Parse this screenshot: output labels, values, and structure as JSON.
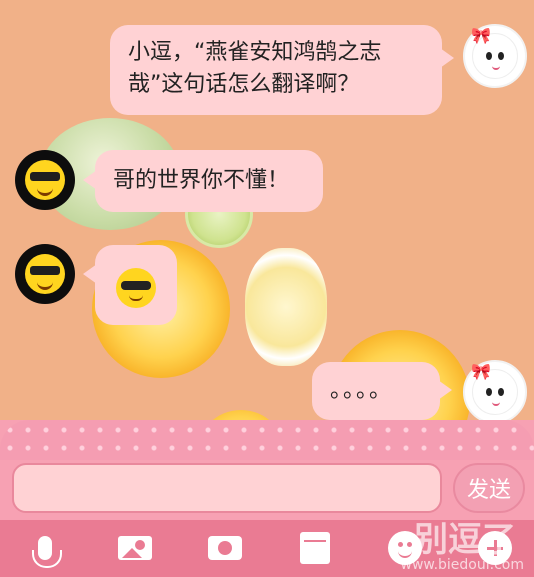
{
  "messages": [
    {
      "side": "right",
      "text": "小逗，“燕雀安知鸿鹄之志哉”这句话怎么翻译啊？"
    },
    {
      "side": "left",
      "text": "哥的世界你不懂！"
    },
    {
      "side": "left",
      "emoji": "cool-face-emoji"
    },
    {
      "side": "right",
      "text": "。。。。"
    }
  ],
  "composer": {
    "input_value": "",
    "send_label": "发送"
  },
  "toolbar": {
    "icons": [
      "microphone-icon",
      "image-icon",
      "camera-icon",
      "envelope-icon",
      "emoji-icon",
      "plus-icon"
    ]
  },
  "watermark": {
    "logo": "别逗了",
    "url": "www.biedoul.com"
  },
  "colors": {
    "bubble": "#ffd2d4",
    "panel": "#f7a1b3",
    "toolbar": "#ea7b93"
  }
}
